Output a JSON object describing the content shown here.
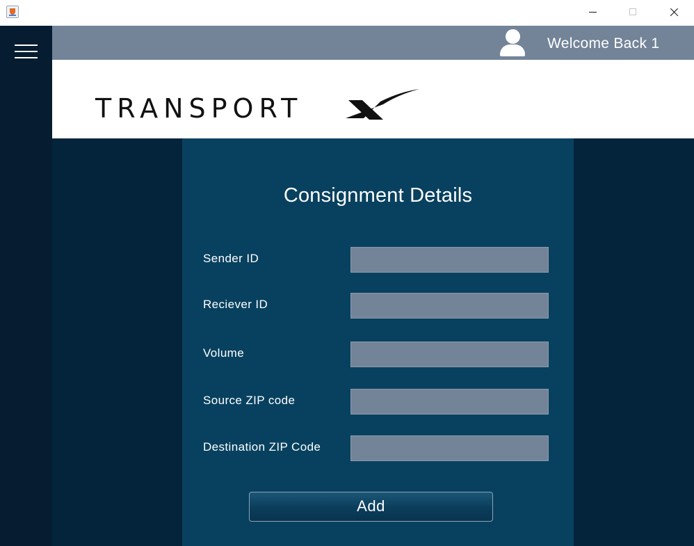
{
  "window": {
    "icon": "java-app-icon",
    "controls": [
      "minimize",
      "maximize",
      "close"
    ]
  },
  "sidebar": {
    "menu_icon": "hamburger-menu-icon"
  },
  "header": {
    "user_icon": "user-icon",
    "welcome_text": "Welcome Back 1"
  },
  "logo": {
    "text": "TRANSPORT"
  },
  "form": {
    "title": "Consignment Details",
    "fields": [
      {
        "label": "Sender ID",
        "value": ""
      },
      {
        "label": "Reciever ID",
        "value": ""
      },
      {
        "label": "Volume",
        "value": ""
      },
      {
        "label": "Source ZIP code",
        "value": ""
      },
      {
        "label": "Destination ZIP Code",
        "value": ""
      }
    ],
    "submit_label": "Add"
  },
  "colors": {
    "sidebar": "#051c31",
    "header": "#738498",
    "content_bg": "#03243a",
    "panel": "#08415f",
    "input": "#738498"
  }
}
